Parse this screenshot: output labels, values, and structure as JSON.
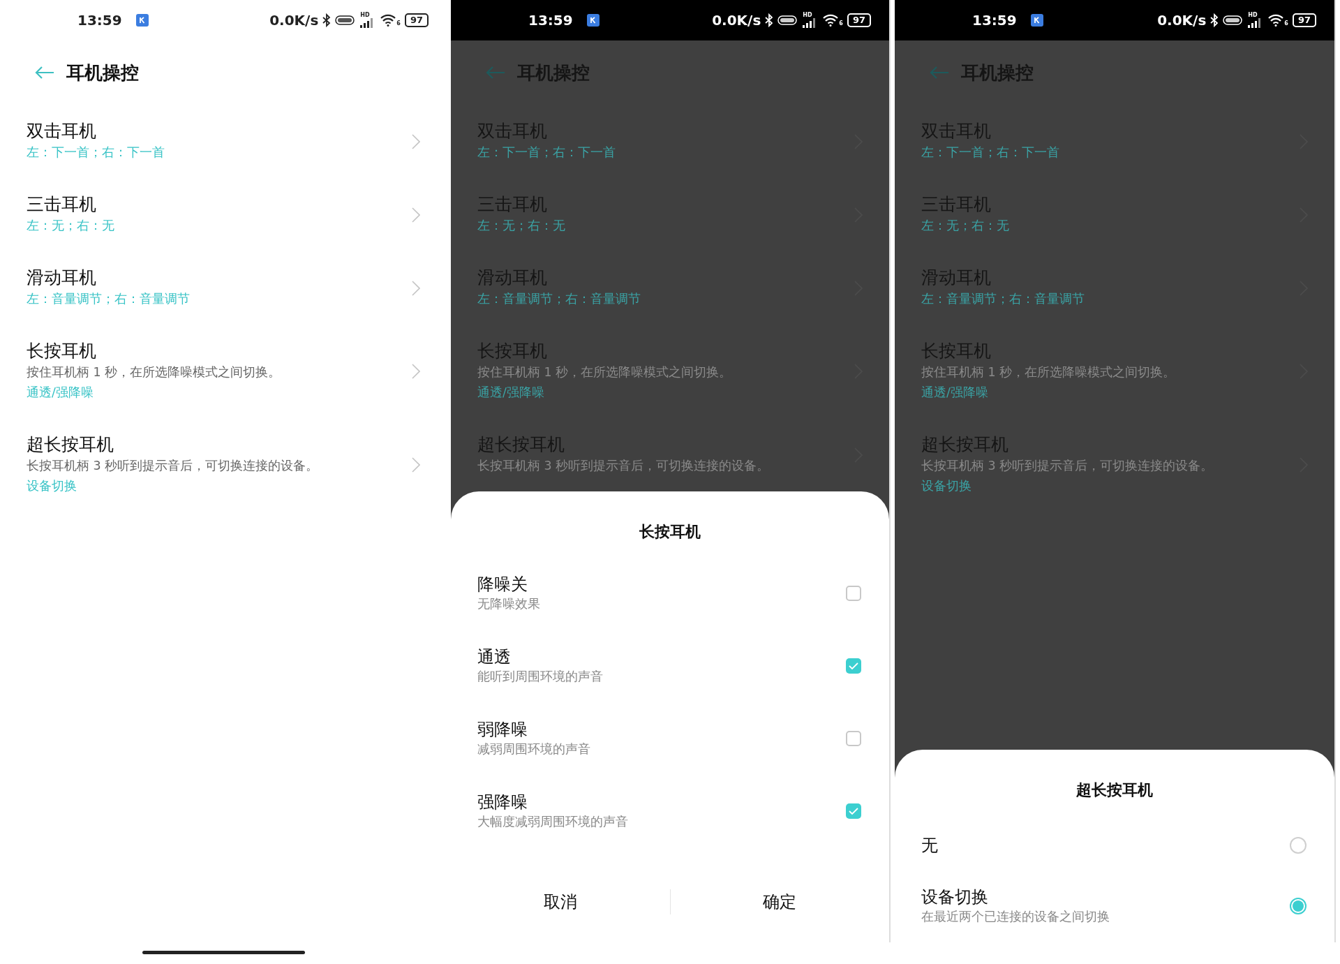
{
  "panels": [
    {
      "dimmed": false,
      "home_indicator": true,
      "status_bar": {
        "time": "13:59",
        "speed": "0.0K/s",
        "signal_label": "HD",
        "wifi_label": "6",
        "battery": "97"
      },
      "header": {
        "title": "耳机操控"
      },
      "items": [
        {
          "title": "双击耳机",
          "value": "左：下一首；右：下一首"
        },
        {
          "title": "三击耳机",
          "value": "左：无；右：无"
        },
        {
          "title": "滑动耳机",
          "value": "左：音量调节；右：音量调节"
        },
        {
          "title": "长按耳机",
          "description": "按住耳机柄 1 秒，在所选降噪模式之间切换。",
          "value": "通透/强降噪"
        },
        {
          "title": "超长按耳机",
          "description": "长按耳机柄 3 秒听到提示音后，可切换连接的设备。",
          "value": "设备切换"
        }
      ]
    },
    {
      "dimmed": true,
      "status_bar": {
        "time": "13:59",
        "speed": "0.0K/s",
        "signal_label": "HD",
        "wifi_label": "6",
        "battery": "97"
      },
      "header": {
        "title": "耳机操控"
      },
      "items": [
        {
          "title": "双击耳机",
          "value": "左：下一首；右：下一首"
        },
        {
          "title": "三击耳机",
          "value": "左：无；右：无"
        },
        {
          "title": "滑动耳机",
          "value": "左：音量调节；右：音量调节"
        },
        {
          "title": "长按耳机",
          "description": "按住耳机柄 1 秒，在所选降噪模式之间切换。",
          "value": "通透/强降噪"
        },
        {
          "title": "超长按耳机",
          "description": "长按耳机柄 3 秒听到提示音后，可切换连接的设备。"
        }
      ],
      "dialog": {
        "kind": "checkbox",
        "title": "长按耳机",
        "options": [
          {
            "label": "降噪关",
            "description": "无降噪效果",
            "checked": false
          },
          {
            "label": "通透",
            "description": "能听到周围环境的声音",
            "checked": true
          },
          {
            "label": "弱降噪",
            "description": "减弱周围环境的声音",
            "checked": false
          },
          {
            "label": "强降噪",
            "description": "大幅度减弱周围环境的声音",
            "checked": true
          }
        ],
        "buttons": [
          "取消",
          "确定"
        ]
      }
    },
    {
      "dimmed": true,
      "status_bar": {
        "time": "13:59",
        "speed": "0.0K/s",
        "signal_label": "HD",
        "wifi_label": "6",
        "battery": "97"
      },
      "header": {
        "title": "耳机操控"
      },
      "items": [
        {
          "title": "双击耳机",
          "value": "左：下一首；右：下一首"
        },
        {
          "title": "三击耳机",
          "value": "左：无；右：无"
        },
        {
          "title": "滑动耳机",
          "value": "左：音量调节；右：音量调节"
        },
        {
          "title": "长按耳机",
          "description": "按住耳机柄 1 秒，在所选降噪模式之间切换。",
          "value": "通透/强降噪"
        },
        {
          "title": "超长按耳机",
          "description": "长按耳机柄 3 秒听到提示音后，可切换连接的设备。",
          "value": "设备切换"
        }
      ],
      "dialog": {
        "kind": "radio",
        "title": "超长按耳机",
        "options": [
          {
            "label": "无",
            "selected": false
          },
          {
            "label": "设备切换",
            "description": "在最近两个已连接的设备之间切换",
            "selected": true
          }
        ]
      }
    }
  ]
}
